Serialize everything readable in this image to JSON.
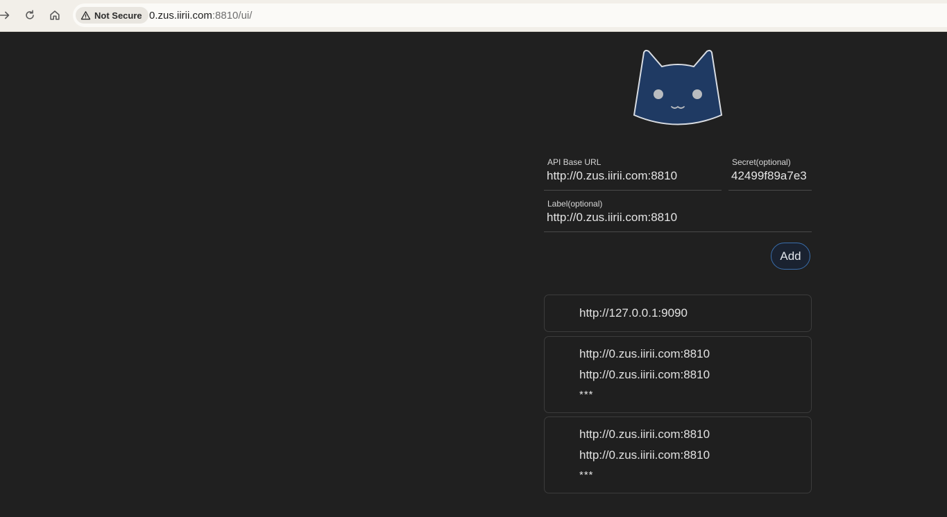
{
  "browser": {
    "security_label": "Not Secure",
    "url_host": "0.zus.iirii.com",
    "url_rest": ":8810/ui/"
  },
  "form": {
    "api_base_url": {
      "label": "API Base URL",
      "value": "http://0.zus.iirii.com:8810"
    },
    "secret": {
      "label": "Secret(optional)",
      "value": "42499f89a7e3"
    },
    "label": {
      "label": "Label(optional)",
      "value": "http://0.zus.iirii.com:8810"
    },
    "add_button": "Add"
  },
  "backends": [
    {
      "url": "http://127.0.0.1:9090"
    },
    {
      "url": "http://0.zus.iirii.com:8810",
      "label": "http://0.zus.iirii.com:8810",
      "secret": "***"
    },
    {
      "url": "http://0.zus.iirii.com:8810",
      "label": "http://0.zus.iirii.com:8810",
      "secret": "***"
    }
  ],
  "colors": {
    "background": "#202020",
    "logo_fill": "#1f3a63",
    "accent_border": "#3a6fae"
  }
}
